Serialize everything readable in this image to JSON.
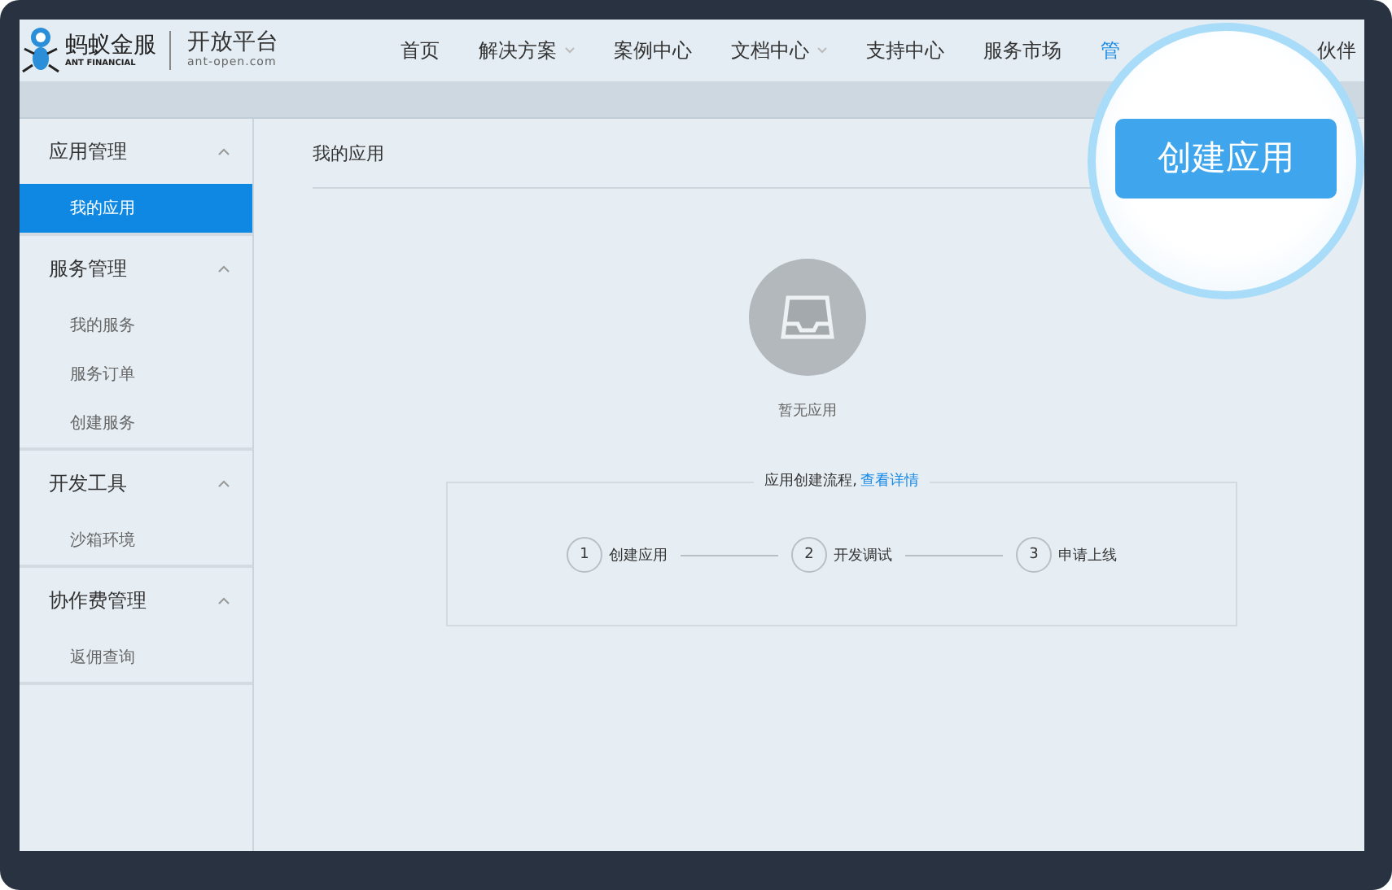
{
  "logo": {
    "brand": "蚂蚁金服",
    "brand_en": "ANT FINANCIAL",
    "product": "开放平台",
    "domain": "ant-open.com"
  },
  "nav": [
    {
      "label": "首页",
      "dropdown": false,
      "selected": false
    },
    {
      "label": "解决方案",
      "dropdown": true,
      "selected": false
    },
    {
      "label": "案例中心",
      "dropdown": false,
      "selected": false
    },
    {
      "label": "文档中心",
      "dropdown": true,
      "selected": false
    },
    {
      "label": "支持中心",
      "dropdown": false,
      "selected": false
    },
    {
      "label": "服务市场",
      "dropdown": false,
      "selected": false
    },
    {
      "label": "管",
      "dropdown": false,
      "selected": true
    },
    {
      "label": "伙伴",
      "dropdown": false,
      "selected": false
    }
  ],
  "sidebar": [
    {
      "title": "应用管理",
      "expanded": true,
      "items": [
        {
          "label": "我的应用",
          "selected": true
        }
      ]
    },
    {
      "title": "服务管理",
      "expanded": true,
      "items": [
        {
          "label": "我的服务",
          "selected": false
        },
        {
          "label": "服务订单",
          "selected": false
        },
        {
          "label": "创建服务",
          "selected": false
        }
      ]
    },
    {
      "title": "开发工具",
      "expanded": true,
      "items": [
        {
          "label": "沙箱环境",
          "selected": false
        }
      ]
    },
    {
      "title": "协作费管理",
      "expanded": true,
      "items": [
        {
          "label": "返佣查询",
          "selected": false
        }
      ]
    }
  ],
  "page_title": "我的应用",
  "empty_text": "暂无应用",
  "process": {
    "title": "应用创建流程,",
    "link": "查看详情",
    "steps": [
      {
        "number": "1",
        "label": "创建应用"
      },
      {
        "number": "2",
        "label": "开发调试"
      },
      {
        "number": "3",
        "label": "申请上线"
      }
    ]
  },
  "magnified_button": "创建应用"
}
